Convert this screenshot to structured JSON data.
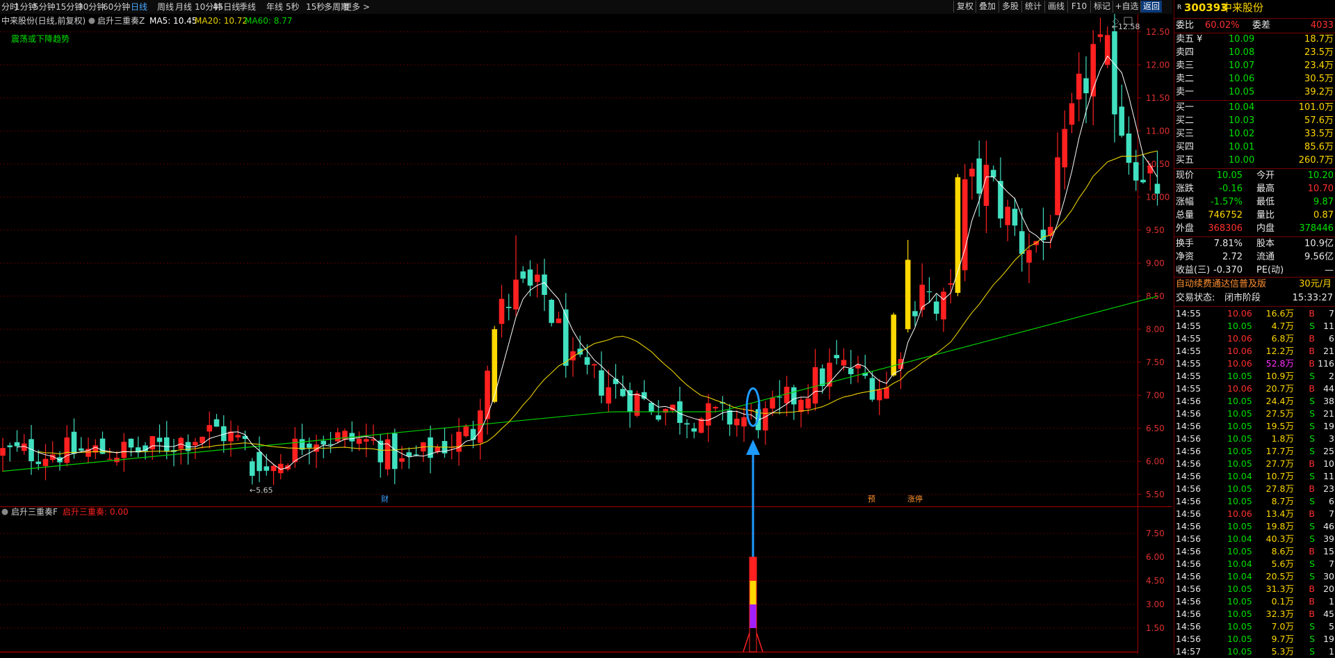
{
  "toolbar": {
    "left_items": [
      "分时",
      "1分钟",
      "5分钟",
      "15分钟",
      "30分钟",
      "60分钟",
      "日线",
      "周线",
      "月线",
      "10分钟",
      "45日线",
      "季线",
      "年线",
      "5秒",
      "15秒",
      "多周期",
      "更多 >"
    ],
    "active_index": 6,
    "right_items": [
      "复权",
      "叠加",
      "多股",
      "统计",
      "画线",
      "F10",
      "标记",
      "+自选",
      "返回"
    ]
  },
  "chart_header": {
    "title": "中来股份(日线,前复权)",
    "indicator": "启升三重奏Z",
    "ma5": "MA5: 10.45",
    "ma20": "MA20: 10.72",
    "ma60": "MA60: 8.77",
    "trend_note": "震荡或下降趋势",
    "high_label": "12.58",
    "low_label": "5.65",
    "event_markers": [
      "财",
      "预",
      "涨停"
    ]
  },
  "sub_header": {
    "name": "启升三重奏F",
    "value": "启升三重奏: 0.00"
  },
  "colors": {
    "up": "#ff2020",
    "down": "#40e0c0",
    "ma5": "#ffffff",
    "ma20": "#e8d000",
    "ma60": "#00d000",
    "signal": "#ffd800",
    "arrow": "#1e9bff"
  },
  "chart_data": {
    "type": "candlestick",
    "y_axis_ticks": [
      "12.50",
      "12.00",
      "11.50",
      "11.00",
      "10.50",
      "10.00",
      "9.50",
      "9.00",
      "8.50",
      "8.00",
      "7.50",
      "7.00",
      "6.50",
      "6.00",
      "5.50"
    ],
    "ylim": [
      5.35,
      12.75
    ],
    "sub_y_axis_ticks": [
      "7.50",
      "6.00",
      "4.50",
      "3.00",
      "1.50"
    ],
    "sub_ylim": [
      0,
      9
    ],
    "series": [
      {
        "name": "MA5"
      },
      {
        "name": "MA20"
      },
      {
        "name": "MA60"
      }
    ],
    "signal_bars": [
      {
        "value": 6,
        "segments": [
          [
            "#ff2020",
            1.5
          ],
          [
            "#ffd800",
            1.5
          ],
          [
            "#a020ff",
            1.5
          ],
          [
            "#000000",
            1.5
          ]
        ]
      }
    ]
  },
  "quote": {
    "code": "300393",
    "name": "中来股份",
    "weibi_label": "委比",
    "weibi": "60.02%",
    "weicha_label": "委差",
    "weicha": "4033",
    "sells": [
      {
        "label": "卖五 ¥",
        "price": "10.09",
        "vol": "18.7万"
      },
      {
        "label": "卖四",
        "price": "10.08",
        "vol": "23.5万"
      },
      {
        "label": "卖三",
        "price": "10.07",
        "vol": "23.4万"
      },
      {
        "label": "卖二",
        "price": "10.06",
        "vol": "30.5万"
      },
      {
        "label": "卖一",
        "price": "10.05",
        "vol": "39.2万"
      }
    ],
    "buys": [
      {
        "label": "买一",
        "price": "10.04",
        "vol": "101.0万"
      },
      {
        "label": "买二",
        "price": "10.03",
        "vol": "57.6万"
      },
      {
        "label": "买三",
        "price": "10.02",
        "vol": "33.5万"
      },
      {
        "label": "买四",
        "price": "10.01",
        "vol": "85.6万"
      },
      {
        "label": "买五",
        "price": "10.00",
        "vol": "260.7万"
      }
    ],
    "stats": [
      {
        "l1": "现价",
        "v1": "10.05",
        "c1": "green",
        "l2": "今开",
        "v2": "10.20",
        "c2": "green"
      },
      {
        "l1": "涨跌",
        "v1": "-0.16",
        "c1": "green",
        "l2": "最高",
        "v2": "10.70",
        "c2": "red"
      },
      {
        "l1": "涨幅",
        "v1": "-1.57%",
        "c1": "green",
        "l2": "最低",
        "v2": "9.87",
        "c2": "green"
      },
      {
        "l1": "总量",
        "v1": "746752",
        "c1": "yellow",
        "l2": "量比",
        "v2": "0.87",
        "c2": "yellow"
      },
      {
        "l1": "外盘",
        "v1": "368306",
        "c1": "red",
        "l2": "内盘",
        "v2": "378446",
        "c2": "green"
      }
    ],
    "stats2": [
      {
        "l1": "换手",
        "v1": "7.81%",
        "l2": "股本",
        "v2": "10.9亿"
      },
      {
        "l1": "净资",
        "v1": "2.72",
        "l2": "流通",
        "v2": "9.56亿"
      },
      {
        "l1": "收益(三)",
        "v1": "-0.370",
        "l2": "PE(动)",
        "v2": "—"
      }
    ],
    "promo": "自动续费通达信普及版",
    "promo_price": "30元/月",
    "status_label": "交易状态:",
    "status": "闭市阶段",
    "status_time": "15:33:27"
  },
  "ticks": [
    {
      "t": "14:55",
      "p": "10.06",
      "pc": "red",
      "v": "16.6万",
      "vc": "yellow",
      "d": "B",
      "n": "7"
    },
    {
      "t": "14:55",
      "p": "10.05",
      "pc": "green",
      "v": "4.7万",
      "vc": "yellow",
      "d": "S",
      "n": "11"
    },
    {
      "t": "14:55",
      "p": "10.06",
      "pc": "red",
      "v": "6.8万",
      "vc": "yellow",
      "d": "B",
      "n": "6"
    },
    {
      "t": "14:55",
      "p": "10.06",
      "pc": "red",
      "v": "12.2万",
      "vc": "yellow",
      "d": "B",
      "n": "21"
    },
    {
      "t": "14:55",
      "p": "10.06",
      "pc": "red",
      "v": "52.8万",
      "vc": "magenta",
      "d": "B",
      "n": "116"
    },
    {
      "t": "14:55",
      "p": "10.05",
      "pc": "green",
      "v": "10.9万",
      "vc": "yellow",
      "d": "S",
      "n": "2"
    },
    {
      "t": "14:55",
      "p": "10.06",
      "pc": "red",
      "v": "20.7万",
      "vc": "yellow",
      "d": "B",
      "n": "44"
    },
    {
      "t": "14:56",
      "p": "10.05",
      "pc": "green",
      "v": "24.4万",
      "vc": "yellow",
      "d": "S",
      "n": "38"
    },
    {
      "t": "14:56",
      "p": "10.05",
      "pc": "green",
      "v": "27.5万",
      "vc": "yellow",
      "d": "S",
      "n": "21"
    },
    {
      "t": "14:56",
      "p": "10.05",
      "pc": "green",
      "v": "19.5万",
      "vc": "yellow",
      "d": "S",
      "n": "19"
    },
    {
      "t": "14:56",
      "p": "10.05",
      "pc": "green",
      "v": "1.8万",
      "vc": "yellow",
      "d": "S",
      "n": "3"
    },
    {
      "t": "14:56",
      "p": "10.05",
      "pc": "green",
      "v": "17.7万",
      "vc": "yellow",
      "d": "S",
      "n": "25"
    },
    {
      "t": "14:56",
      "p": "10.05",
      "pc": "green",
      "v": "27.7万",
      "vc": "yellow",
      "d": "B",
      "n": "10"
    },
    {
      "t": "14:56",
      "p": "10.04",
      "pc": "green",
      "v": "10.7万",
      "vc": "yellow",
      "d": "S",
      "n": "11"
    },
    {
      "t": "14:56",
      "p": "10.05",
      "pc": "green",
      "v": "27.8万",
      "vc": "yellow",
      "d": "B",
      "n": "23"
    },
    {
      "t": "14:56",
      "p": "10.05",
      "pc": "green",
      "v": "8.7万",
      "vc": "yellow",
      "d": "S",
      "n": "6"
    },
    {
      "t": "14:56",
      "p": "10.06",
      "pc": "red",
      "v": "13.4万",
      "vc": "yellow",
      "d": "B",
      "n": "7"
    },
    {
      "t": "14:56",
      "p": "10.05",
      "pc": "green",
      "v": "19.8万",
      "vc": "yellow",
      "d": "S",
      "n": "46"
    },
    {
      "t": "14:56",
      "p": "10.04",
      "pc": "green",
      "v": "40.3万",
      "vc": "yellow",
      "d": "S",
      "n": "39"
    },
    {
      "t": "14:56",
      "p": "10.05",
      "pc": "green",
      "v": "8.6万",
      "vc": "yellow",
      "d": "B",
      "n": "15"
    },
    {
      "t": "14:56",
      "p": "10.04",
      "pc": "green",
      "v": "5.6万",
      "vc": "yellow",
      "d": "S",
      "n": "7"
    },
    {
      "t": "14:56",
      "p": "10.04",
      "pc": "green",
      "v": "20.5万",
      "vc": "yellow",
      "d": "S",
      "n": "30"
    },
    {
      "t": "14:56",
      "p": "10.05",
      "pc": "green",
      "v": "31.3万",
      "vc": "yellow",
      "d": "B",
      "n": "20"
    },
    {
      "t": "14:56",
      "p": "10.05",
      "pc": "green",
      "v": "0.1万",
      "vc": "yellow",
      "d": "B",
      "n": "1"
    },
    {
      "t": "14:56",
      "p": "10.05",
      "pc": "green",
      "v": "32.3万",
      "vc": "yellow",
      "d": "B",
      "n": "45"
    },
    {
      "t": "14:56",
      "p": "10.05",
      "pc": "green",
      "v": "7.0万",
      "vc": "yellow",
      "d": "S",
      "n": "5"
    },
    {
      "t": "14:56",
      "p": "10.05",
      "pc": "green",
      "v": "9.7万",
      "vc": "yellow",
      "d": "S",
      "n": "19"
    },
    {
      "t": "14:57",
      "p": "10.05",
      "pc": "green",
      "v": "5.3万",
      "vc": "yellow",
      "d": "S",
      "n": "1"
    }
  ]
}
